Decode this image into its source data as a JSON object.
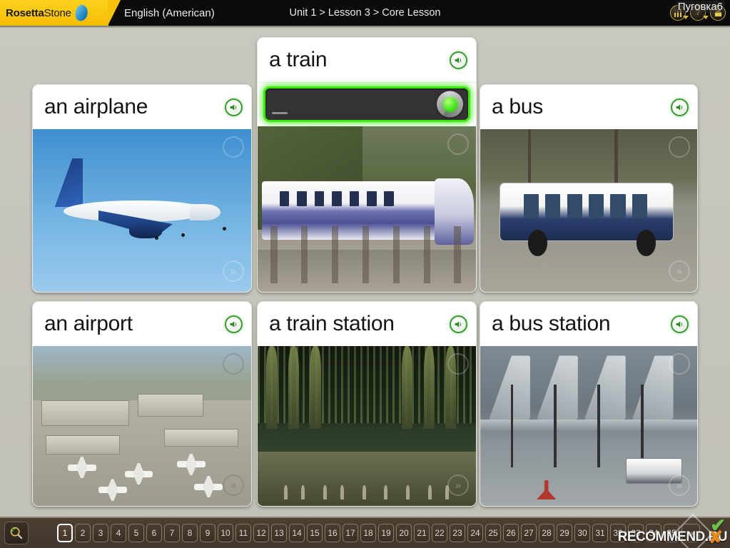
{
  "app": {
    "brand_first": "Rosetta",
    "brand_second": "Stone",
    "language": "English (American)",
    "breadcrumb": "Unit 1 > Lesson 3 > Core Lesson",
    "username": "Пуговка6"
  },
  "header_icons": [
    {
      "name": "lesson-list-icon",
      "label": ""
    },
    {
      "name": "help-icon",
      "label": "?"
    },
    {
      "name": "exit-icon",
      "label": ""
    }
  ],
  "cards": [
    {
      "id": "an-airplane",
      "word": "an airplane",
      "speaker_label": "speaker-icon",
      "active": false,
      "scene": "airplane",
      "overlay_glyph": "»"
    },
    {
      "id": "a-train",
      "word": "a train",
      "speaker_label": "speaker-icon",
      "active": true,
      "scene": "train",
      "overlay_glyph": "»"
    },
    {
      "id": "a-bus",
      "word": "a bus",
      "speaker_label": "speaker-icon",
      "active": false,
      "scene": "bus",
      "overlay_glyph": "»"
    },
    {
      "id": "an-airport",
      "word": "an airport",
      "speaker_label": "speaker-icon",
      "active": false,
      "scene": "airport",
      "overlay_glyph": "»"
    },
    {
      "id": "a-train-station",
      "word": "a train station",
      "speaker_label": "speaker-icon",
      "active": false,
      "scene": "trainstation",
      "overlay_glyph": "»"
    },
    {
      "id": "a-bus-station",
      "word": "a bus station",
      "speaker_label": "speaker-icon",
      "active": false,
      "scene": "busstation",
      "overlay_glyph": "»"
    }
  ],
  "speech": {
    "recording_active": true,
    "mic_state": "listening"
  },
  "bottom_bar": {
    "zoom_icon": "magnifier-icon",
    "current_page": 1,
    "pages": [
      1,
      2,
      3,
      4,
      5,
      6,
      7,
      8,
      9,
      10,
      11,
      12,
      13,
      14,
      15,
      16,
      17,
      18,
      19,
      20,
      21,
      22,
      23,
      24,
      25,
      26,
      27,
      28,
      29,
      30,
      31,
      32,
      33,
      34,
      35
    ],
    "next_label": "»"
  },
  "watermark": {
    "text": "RECOMMEND.RU",
    "check": "✔",
    "cross": "✘"
  },
  "colors": {
    "brand_yellow": "#f6c00b",
    "accent_green": "#3ee813",
    "speaker_green": "#3a9b35",
    "page_bg": "#c7c6be",
    "bottom_bar": "#43362b"
  }
}
